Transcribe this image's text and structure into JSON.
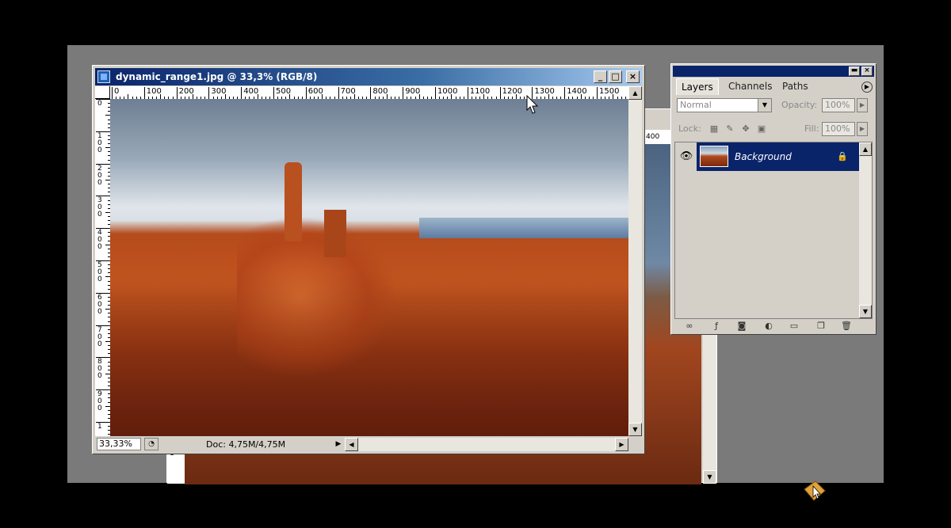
{
  "background_document": {
    "ruler_value": "400",
    "ruler_left": "1"
  },
  "document": {
    "title": "dynamic_range1.jpg @ 33,3% (RGB/8)",
    "ruler_h": [
      "0",
      "100",
      "200",
      "300",
      "400",
      "500",
      "600",
      "700",
      "800",
      "900",
      "1000",
      "1100",
      "1200",
      "1300",
      "1400",
      "1500"
    ],
    "ruler_v": [
      "0",
      "100",
      "200",
      "300",
      "400",
      "500",
      "600",
      "700",
      "800",
      "900",
      "1"
    ],
    "zoom": "33,33%",
    "doc_info": "Doc: 4,75M/4,75M",
    "buttons": {
      "minimize": "_",
      "maximize": "□",
      "close": "×"
    }
  },
  "layers_panel": {
    "tabs": [
      "Layers",
      "Channels",
      "Paths"
    ],
    "blend_mode": "Normal",
    "opacity_label": "Opacity:",
    "opacity_value": "100%",
    "lock_label": "Lock:",
    "fill_label": "Fill:",
    "fill_value": "100%",
    "layers": [
      {
        "name": "Background",
        "visible": true,
        "locked": true,
        "selected": true
      }
    ]
  },
  "colors": {
    "titlebar_start": "#0a246a",
    "titlebar_end": "#a6caf0",
    "panel_bg": "#d4d0c8",
    "selection": "#0a246a",
    "workspace": "#7a7a7a"
  },
  "icons": [
    "photoshop-doc-icon",
    "minimize-icon",
    "maximize-icon",
    "close-icon",
    "eye-icon",
    "lock-icon",
    "link-icon",
    "layer-style-icon",
    "mask-icon",
    "adjustment-icon",
    "folder-icon",
    "new-layer-icon",
    "trash-icon",
    "mouse-cursor-icon"
  ]
}
